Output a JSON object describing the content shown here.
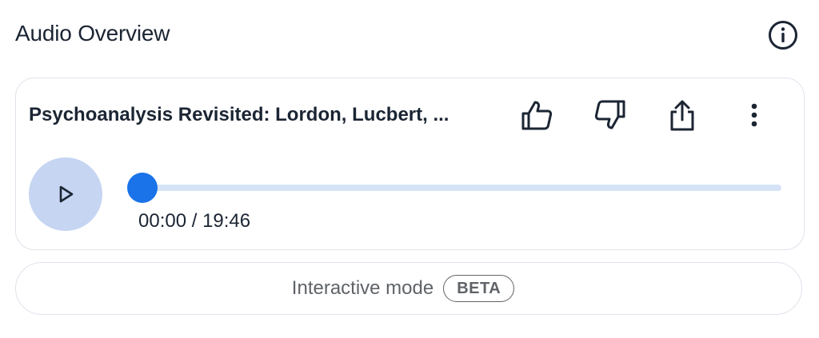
{
  "header": {
    "title": "Audio Overview",
    "info_icon": "info-icon"
  },
  "player": {
    "episode_title": "Psychoanalysis Revisited: Lordon, Lucbert, ...",
    "actions": [
      {
        "name": "thumbs-up-icon"
      },
      {
        "name": "thumbs-down-icon"
      },
      {
        "name": "share-icon"
      },
      {
        "name": "more-vert-icon"
      }
    ],
    "play_icon": "play-icon",
    "progress_fraction": 0.0,
    "time_readout": "00:00 / 19:46",
    "colors": {
      "accent": "#1a73e8",
      "track": "#d6e3f7",
      "play_bg": "#c5d5f2"
    }
  },
  "interactive": {
    "label": "Interactive mode",
    "badge": "BETA"
  }
}
